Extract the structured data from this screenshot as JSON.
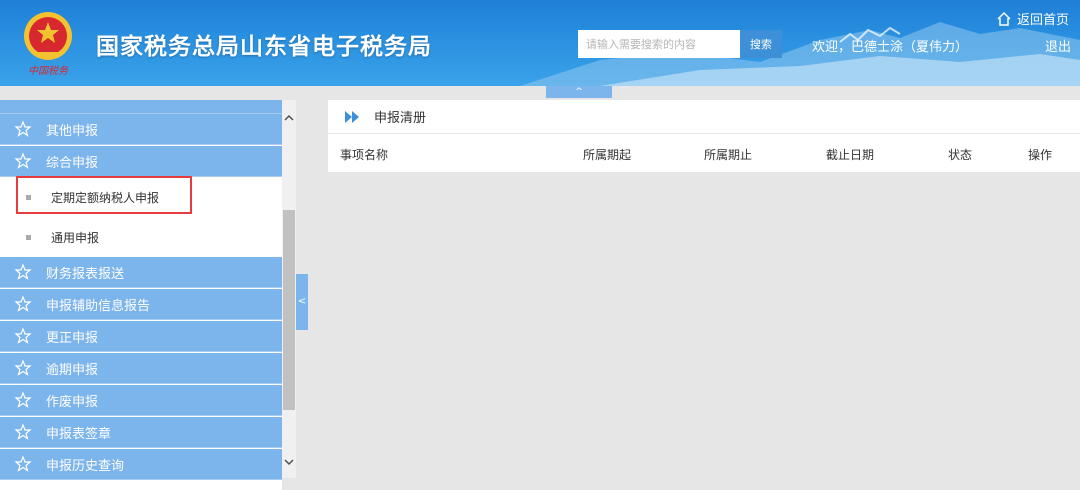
{
  "header": {
    "title": "国家税务总局山东省电子税务局",
    "search_placeholder": "请输入需要搜索的内容",
    "search_button": "搜索",
    "welcome": "欢迎，巴德士涂（夏伟力）",
    "home": "返回首页",
    "logout": "退出",
    "collapse_glyph": "^"
  },
  "sidebar": {
    "items": [
      {
        "label": "其他申报"
      },
      {
        "label": "综合申报"
      },
      {
        "label": "财务报表报送"
      },
      {
        "label": "申报辅助信息报告"
      },
      {
        "label": "更正申报"
      },
      {
        "label": "逾期申报"
      },
      {
        "label": "作废申报"
      },
      {
        "label": "申报表签章"
      },
      {
        "label": "申报历史查询"
      }
    ],
    "sub_items": [
      {
        "label": "定期定额纳税人申报",
        "selected": true
      },
      {
        "label": "通用申报"
      }
    ],
    "collapse_glyph": "<"
  },
  "panel": {
    "title": "申报清册",
    "columns": [
      "事项名称",
      "所属期起",
      "所属期止",
      "截止日期",
      "状态",
      "操作"
    ]
  },
  "colors": {
    "header_blue": "#2a90e0",
    "nav_blue": "#7cb4ec",
    "highlight_red": "#e83b3b"
  }
}
